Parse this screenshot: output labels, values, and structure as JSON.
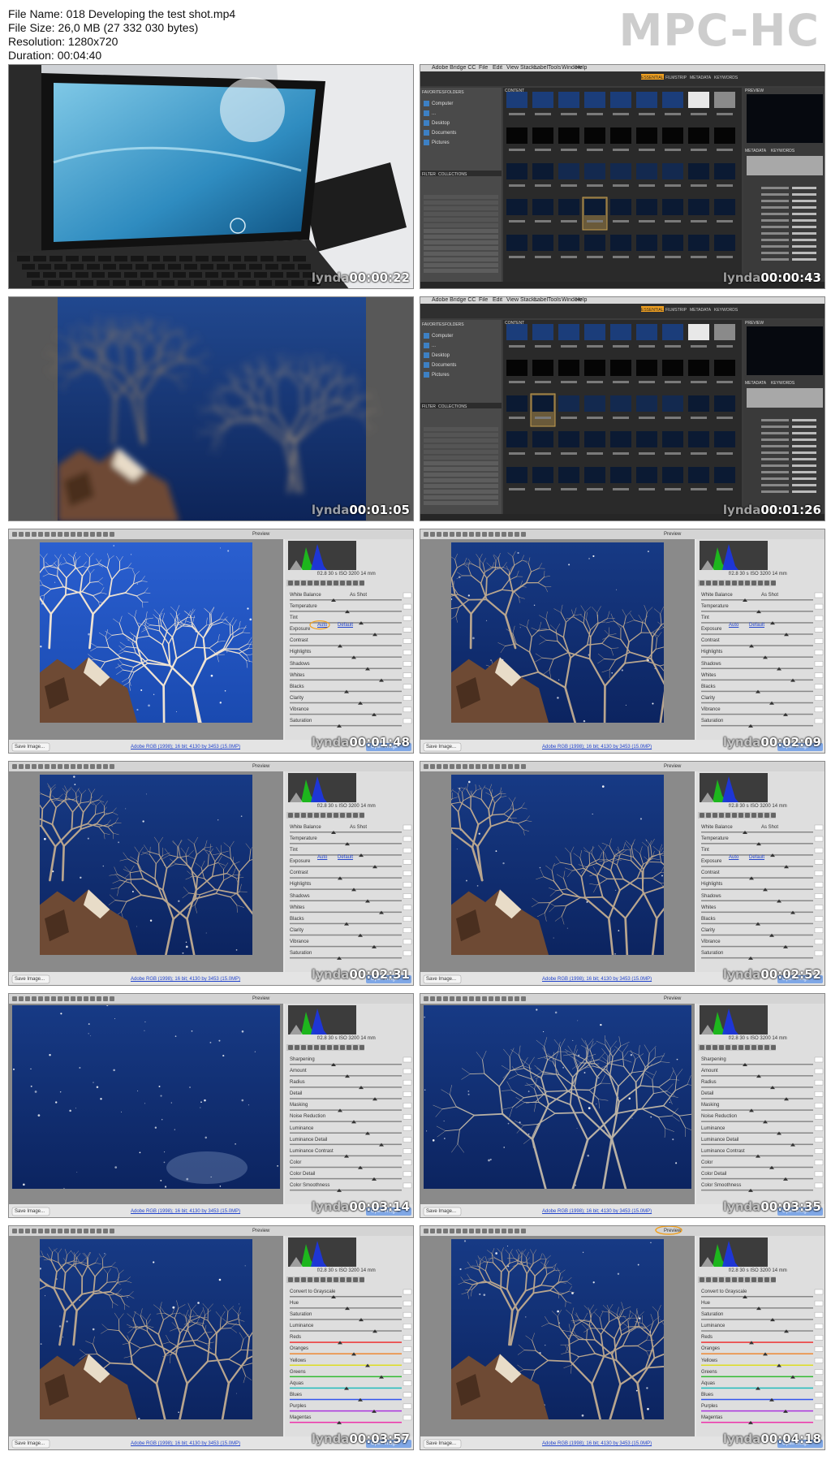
{
  "file_info": {
    "name": "File Name: 018 Developing the test shot.mp4",
    "size": "File Size: 26,0 MB (27 332 030 bytes)",
    "resolution": "Resolution: 1280x720",
    "duration": "Duration: 00:04:40"
  },
  "player_logo": "MPC-HC",
  "watermark": "lynda",
  "bridge": {
    "app_name": "Adobe Bridge CC",
    "menu": [
      "File",
      "Edit",
      "View",
      "Stacks",
      "Label",
      "Tools",
      "Window",
      "Help"
    ],
    "panel_favorites": "FAVORITES",
    "panel_folders": "FOLDERS",
    "panel_filter": "FILTER",
    "panel_collections": "COLLECTIONS",
    "favorites_items": [
      "Computer",
      "...",
      "Desktop",
      "Documents",
      "Pictures"
    ],
    "workspace_tabs": [
      "ESSENTIALS",
      "FILMSTRIP",
      "METADATA",
      "KEYWORDS"
    ],
    "content_tab": "CONTENT",
    "preview_tab": "PREVIEW",
    "metadata_tab": "METADATA",
    "keywords_tab": "KEYWORDS"
  },
  "acr": {
    "preview_label": "Preview",
    "save_image": "Save Image...",
    "workflow_link": "Adobe RGB (1998); 16 bit; 4130 by 3453 (15.0MP)",
    "open_image": "Open Image",
    "basic_labels": [
      "White Balance",
      "Temperature",
      "Tint",
      "Exposure",
      "Contrast",
      "Highlights",
      "Shadows",
      "Whites",
      "Blacks",
      "Clarity",
      "Vibrance",
      "Saturation"
    ],
    "detail_labels": [
      "Sharpening",
      "Amount",
      "Radius",
      "Detail",
      "Masking",
      "Noise Reduction",
      "Luminance",
      "Luminance Detail",
      "Luminance Contrast",
      "Color",
      "Color Detail",
      "Color Smoothness"
    ],
    "hsl_labels": [
      "Convert to Grayscale",
      "Hue",
      "Saturation",
      "Luminance",
      "Reds",
      "Oranges",
      "Yellows",
      "Greens",
      "Aquas",
      "Blues",
      "Purples",
      "Magentas"
    ],
    "auto": "Auto",
    "default": "Default",
    "wb_value": "As Shot",
    "cam_info": "f/2.8  30 s  ISO 3200  14 mm"
  },
  "frames": [
    {
      "timestamp": "00:00:22"
    },
    {
      "timestamp": "00:00:43"
    },
    {
      "timestamp": "00:01:05"
    },
    {
      "timestamp": "00:01:26"
    },
    {
      "timestamp": "00:01:48"
    },
    {
      "timestamp": "00:02:09"
    },
    {
      "timestamp": "00:02:31"
    },
    {
      "timestamp": "00:02:52"
    },
    {
      "timestamp": "00:03:14"
    },
    {
      "timestamp": "00:03:35"
    },
    {
      "timestamp": "00:03:57"
    },
    {
      "timestamp": "00:04:18"
    }
  ],
  "colors": {
    "night_sky": "#0e2d6e",
    "bright_sky": "#1b57c2",
    "bridge_bg": "#4a4a4a",
    "acr_bg": "#cfcfcf",
    "highlight_orange": "#f0a020"
  }
}
